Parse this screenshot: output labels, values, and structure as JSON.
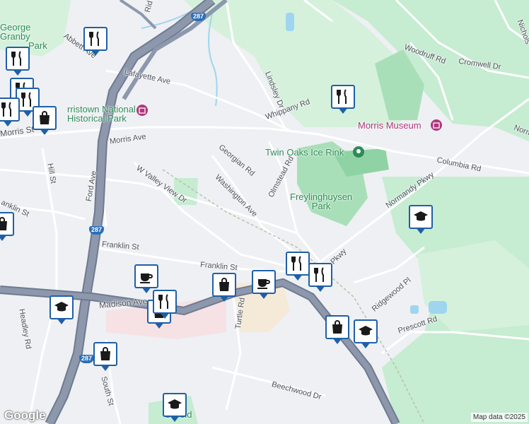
{
  "map": {
    "attribution": "Map data ©2025",
    "logo": "Google",
    "colors": {
      "land": "#eef0f3",
      "park": "#c6ecd1",
      "park_dark": "#a9dfb8",
      "water": "#9fd5ee",
      "highway": "#8d98ad",
      "highway_outline": "#6f7a90",
      "road": "#ffffff",
      "pin_border": "#1f5fa8"
    },
    "streets": [
      {
        "id": "abbett-ave",
        "name": "Abbett Ave"
      },
      {
        "id": "lafayette-ave",
        "name": "Lafayette Ave"
      },
      {
        "id": "lindsley-dr",
        "name": "Lindsley Dr"
      },
      {
        "id": "whippany-rd",
        "name": "Whippany Rd"
      },
      {
        "id": "woodruff-rd",
        "name": "Woodruff Rd"
      },
      {
        "id": "cromwell-dr",
        "name": "Cromwell Dr"
      },
      {
        "id": "morris-ave",
        "name": "Morris Ave"
      },
      {
        "id": "georgian-rd",
        "name": "Georgian Rd"
      },
      {
        "id": "olmstead-rd",
        "name": "Olmstead Rd"
      },
      {
        "id": "columbia-rd",
        "name": "Columbia Rd"
      },
      {
        "id": "hill-st",
        "name": "Hill St"
      },
      {
        "id": "ford-ave",
        "name": "Ford Ave"
      },
      {
        "id": "w-valley-view-dr",
        "name": "W Valley View Dr"
      },
      {
        "id": "washington-ave",
        "name": "Washington Ave"
      },
      {
        "id": "normandy-pkwy",
        "name": "Normandy Pkwy"
      },
      {
        "id": "franklin-st-left",
        "name": "anklin St"
      },
      {
        "id": "franklin-st",
        "name": "Franklin St"
      },
      {
        "id": "franklin-st-2",
        "name": "Franklin St"
      },
      {
        "id": "pkwy",
        "name": "Pkwy"
      },
      {
        "id": "madison-ave",
        "name": "Madison Ave"
      },
      {
        "id": "turtle-rd",
        "name": "Turtle Rd"
      },
      {
        "id": "ridgewood-pl",
        "name": "Ridgewood Pl"
      },
      {
        "id": "headley-rd",
        "name": "Headley Rd"
      },
      {
        "id": "prescott-rd",
        "name": "Prescott Rd"
      },
      {
        "id": "south-st",
        "name": "South St"
      },
      {
        "id": "beechwood-dr",
        "name": "Beechwood Dr"
      },
      {
        "id": "morris-st",
        "name": "Morris St"
      },
      {
        "id": "rid-road",
        "name": "Rid"
      },
      {
        "id": "nichols",
        "name": "Nichols"
      },
      {
        "id": "norm",
        "name": "Norm"
      }
    ],
    "places": [
      {
        "id": "morristown-nhp",
        "name": "Morristown National Historical Park",
        "line1": "rristown National",
        "line2": "Historical Park",
        "color": "green"
      },
      {
        "id": "george-granby-park",
        "name": "George Granby Park",
        "line1": "George",
        "line2": "Granby",
        "line3": "Park",
        "color": "green"
      },
      {
        "id": "twin-oaks-ice-rink",
        "name": "Twin Oaks Ice Rink",
        "color": "green"
      },
      {
        "id": "freylinghuysen-park",
        "name": "Freylinghuysen Park",
        "line1": "Freylinghuysen",
        "line2": "Park",
        "color": "green"
      },
      {
        "id": "morris-museum",
        "name": "Morris Museum",
        "color": "pink"
      },
      {
        "id": "green-field",
        "name": "Green Field",
        "line1": "G",
        "line2": "eld",
        "color": "green"
      }
    ],
    "highway_shields": [
      "287",
      "287",
      "287"
    ],
    "markers": [
      {
        "type": "restaurant",
        "icon": "fork-knife-icon"
      },
      {
        "type": "restaurant",
        "icon": "fork-knife-icon"
      },
      {
        "type": "restaurant",
        "icon": "fork-knife-icon"
      },
      {
        "type": "restaurant",
        "icon": "fork-knife-icon"
      },
      {
        "type": "restaurant",
        "icon": "fork-knife-icon"
      },
      {
        "type": "restaurant",
        "icon": "fork-knife-icon"
      },
      {
        "type": "shopping",
        "icon": "shopping-bag-icon"
      },
      {
        "type": "shopping",
        "icon": "shopping-bag-icon"
      },
      {
        "type": "shopping",
        "icon": "shopping-bag-icon"
      },
      {
        "type": "shopping",
        "icon": "shopping-bag-icon"
      },
      {
        "type": "shopping",
        "icon": "shopping-bag-icon"
      },
      {
        "type": "cafe",
        "icon": "coffee-cup-icon"
      },
      {
        "type": "cafe",
        "icon": "coffee-cup-icon"
      },
      {
        "type": "school",
        "icon": "graduation-cap-icon"
      },
      {
        "type": "school",
        "icon": "graduation-cap-icon"
      },
      {
        "type": "school",
        "icon": "graduation-cap-icon"
      },
      {
        "type": "school",
        "icon": "graduation-cap-icon"
      },
      {
        "type": "restaurant",
        "icon": "fork-knife-icon"
      },
      {
        "type": "restaurant",
        "icon": "fork-knife-icon"
      },
      {
        "type": "restaurant",
        "icon": "fork-knife-icon"
      }
    ]
  }
}
